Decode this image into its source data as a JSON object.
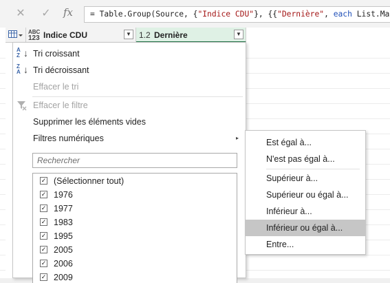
{
  "formula_bar": {
    "cancel_icon": "x-mark-icon",
    "confirm_icon": "check-icon",
    "fx_label": "fx",
    "formula_prefix": "= Table.Group(Source, {",
    "formula_str1": "\"Indice CDU\"",
    "formula_mid": "}, {{",
    "formula_str2": "\"Dernière\"",
    "formula_mid2": ", ",
    "formula_kw": "each",
    "formula_suffix": " List.Max("
  },
  "columns": [
    {
      "type_badge_top": "ABC",
      "type_badge_bottom": "123",
      "label": "Indice CDU"
    },
    {
      "type_badge": "1.2",
      "label": "Dernière"
    }
  ],
  "filter_menu": {
    "sort_asc": "Tri croissant",
    "sort_desc": "Tri décroissant",
    "clear_sort": "Effacer le tri",
    "clear_filter": "Effacer le filtre",
    "remove_empty": "Supprimer les éléments vides",
    "number_filters": "Filtres numériques",
    "search_placeholder": "Rechercher",
    "values": [
      "(Sélectionner tout)",
      "1976",
      "1977",
      "1983",
      "1995",
      "2005",
      "2006",
      "2009"
    ]
  },
  "number_filters_submenu": {
    "items": [
      "Est égal à...",
      "N'est pas égal à...",
      "Supérieur à...",
      "Supérieur ou égal à...",
      "Inférieur à...",
      "Inférieur ou égal à...",
      "Entre..."
    ],
    "hovered_index": 5
  },
  "colors": {
    "accent_green": "#217346",
    "selected_header_bg": "#dff1e5",
    "hover_bg": "#c6c6c6",
    "icon_blue": "#3a64a8"
  }
}
